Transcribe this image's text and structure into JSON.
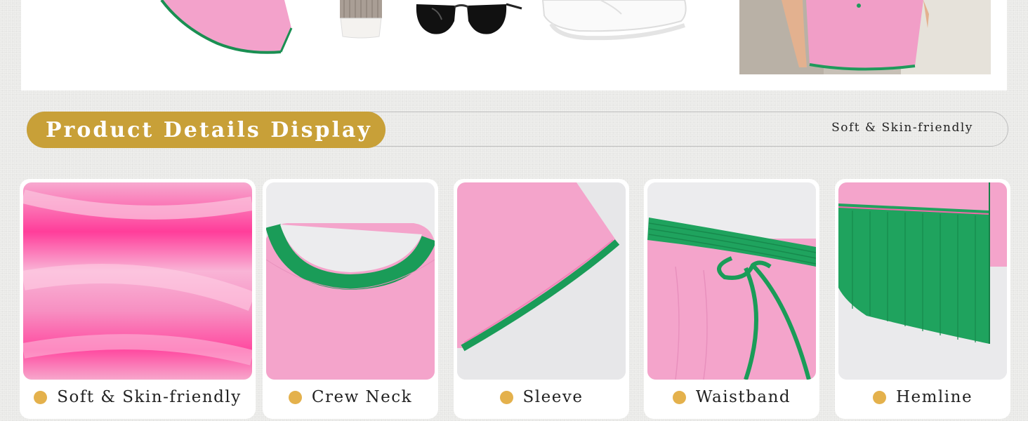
{
  "header": {
    "title": "Product Details Display",
    "subtitle": "Soft & Skin-friendly"
  },
  "top_panel": {
    "accessories": [
      "skirt-icon",
      "cup-icon",
      "sunglasses-icon",
      "sneaker-icon",
      "model-photo"
    ]
  },
  "details": [
    {
      "label": "Soft & Skin-friendly",
      "image": "fabric-closeup"
    },
    {
      "label": "Crew Neck",
      "image": "collar-closeup"
    },
    {
      "label": "Sleeve",
      "image": "sleeve-closeup"
    },
    {
      "label": "Waistband",
      "image": "waistband-closeup"
    },
    {
      "label": "Hemline",
      "image": "hemline-closeup"
    }
  ],
  "colors": {
    "accent_gold": "#c8a038",
    "bullet": "#e4b14c",
    "pink": "#f4a3cb",
    "green": "#1d9a5a"
  }
}
